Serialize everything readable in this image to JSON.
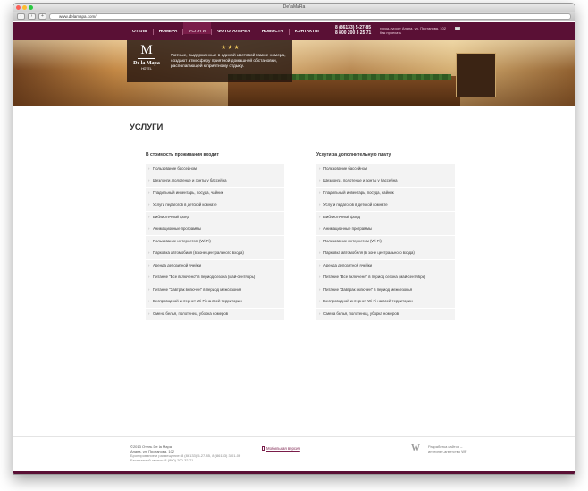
{
  "window": {
    "title": "De'laMaRa",
    "url": "www.delamapa.com/"
  },
  "nav": {
    "items": [
      "Отель",
      "Номера",
      "Услуги",
      "Фотогалерея",
      "Новости",
      "Контакты"
    ],
    "active": "Услуги"
  },
  "contacts": {
    "phone1": "8 (86133) 5-27-85",
    "phone2": "8 800 200 3 25 71",
    "address": "город-курорт Анапа, ул. Протапова, 102",
    "map_link": "Как проехать"
  },
  "hero": {
    "logo_mark": "M",
    "logo_name": "De la Mapa",
    "logo_sub": "HOTEL",
    "stars": "★★★",
    "slogan": "Уютные, выдержанные в единой цветовой гамме номера, создают атмосферу приятной домашней обстановки, располагающей к приятному отдыху."
  },
  "page": {
    "title": "Услуги"
  },
  "included": {
    "heading": "В стоимость проживания входит",
    "items": [
      "Пользование бассейном",
      "Шезлонги, полотенце и зонты у бассейна",
      "Гладильный инвентарь, посуда, чайник",
      "Услуги педагогов в детской комнате",
      "Библиотечный фонд",
      "Анимационные программы",
      "Пользование интернетом (Wi-Fi)",
      "Парковка автомобиля (в зоне центрального входа)",
      "Аренда депозитной ячейки",
      "Питание \"Все включено\" в период сезона (май-сентябрь)",
      "Питание \"Завтрак включен\" в период межсезонья",
      "Беспроводной интернет Wi-Fi на всей территории",
      "Смена белья, полотенец, уборка номеров"
    ]
  },
  "extra": {
    "heading": "Услуги за дополнительную плату",
    "items": [
      "Пользование бассейном",
      "Шезлонги, полотенце и зонты у бассейна",
      "Гладильный инвентарь, посуда, чайник",
      "Услуги педагогов в детской комнате",
      "Библиотечный фонд",
      "Анимационные программы",
      "Пользование интернетом (Wi-Fi)",
      "Парковка автомобиля (в зоне центрального входа)",
      "Аренда депозитной ячейки",
      "Питание \"Все включено\" в период сезона (май-сентябрь)",
      "Питание \"Завтрак включен\" в период межсезонья",
      "Беспроводной интернет Wi-Fi на всей территории",
      "Смена белья, полотенец, уборка номеров"
    ]
  },
  "footer": {
    "copyright": "©2013 Отель De la Mapa",
    "address": "Анапа, ул. Протапова, 102",
    "booking": "Бронирование и размещение: 8 (86133) 5-27-85, 8 (86133) 3-01-09",
    "free_call": "Бесплатный звонок: 8 (800) 200-32-71",
    "mobile": "Мобильная версия",
    "developer_logo": "W",
    "developer_line1": "Разработка сайтов –",
    "developer_line2": "интернет-агентство WF"
  },
  "colors": {
    "brand": "#5a1035",
    "active_tab": "#7a1d4a",
    "row_bg": "#f3f3f3"
  }
}
